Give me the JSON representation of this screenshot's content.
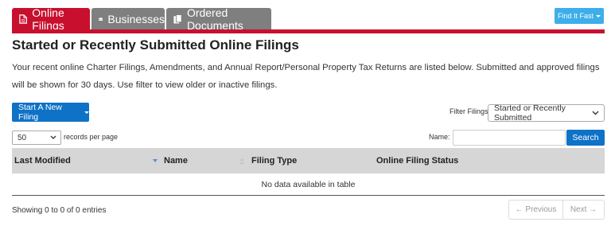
{
  "tabs": [
    {
      "label": "Online Filings",
      "icon": "document-icon",
      "active": true
    },
    {
      "label": "Businesses",
      "icon": "briefcase-icon",
      "active": false
    },
    {
      "label": "Ordered Documents",
      "icon": "copy-icon",
      "active": false
    }
  ],
  "find_it_fast": "Find It Fast",
  "page_title": "Started or Recently Submitted Online Filings",
  "description": "Your recent online Charter Filings, Amendments, and Annual Report/Personal Property Tax Returns are listed below. Submitted and approved filings will be shown for 30 days. Use filter to view older or inactive filings.",
  "start_filing": "Start A New Filing",
  "filter": {
    "label": "Filter Filings:",
    "selected": "Started or Recently Submitted"
  },
  "records": {
    "selected": "50",
    "label": "records per page"
  },
  "name_search": {
    "label": "Name:",
    "value": "",
    "button": "Search"
  },
  "table": {
    "columns": [
      "Last Modified",
      "Name",
      "Filing Type",
      "Online Filing Status"
    ],
    "empty_message": "No data available in table"
  },
  "info": "Showing 0 to 0 of 0 entries",
  "pagination": {
    "previous": "← Previous",
    "next": "Next →"
  },
  "colors": {
    "brand_red": "#c8102e",
    "tab_gray": "#7f7f7f",
    "button_blue": "#0e72c7",
    "light_blue": "#3daee9",
    "header_gray": "#d6d6d6"
  }
}
